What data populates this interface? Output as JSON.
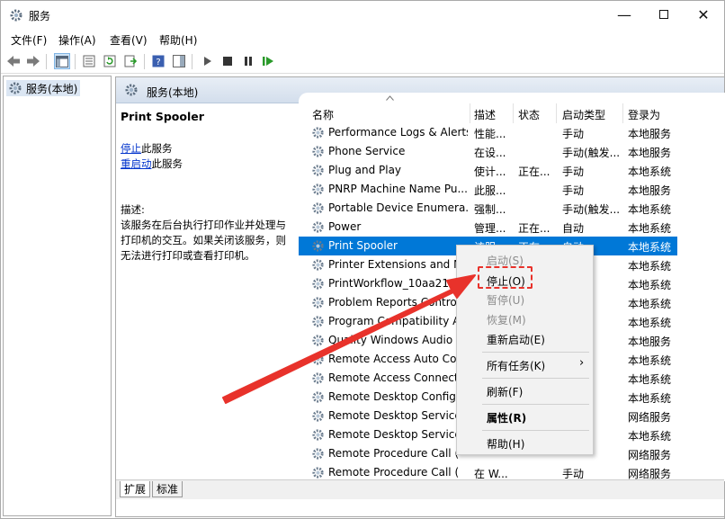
{
  "window": {
    "title": "服务"
  },
  "menu": [
    "文件(F)",
    "操作(A)",
    "查看(V)",
    "帮助(H)"
  ],
  "tree": {
    "root": "服务(本地)"
  },
  "main": {
    "header": "服务(本地)",
    "selected_name": "Print Spooler",
    "stop_link": "停止",
    "stop_suffix": "此服务",
    "restart_link": "重启动",
    "restart_suffix": "此服务",
    "desc_label": "描述:",
    "desc_text": "该服务在后台执行打印作业并处理与打印机的交互。如果关闭该服务，则无法进行打印或查看打印机。"
  },
  "columns": [
    "名称",
    "描述",
    "状态",
    "启动类型",
    "登录为"
  ],
  "rows": [
    [
      "Performance Logs & Alerts",
      "性能...",
      "",
      "手动",
      "本地服务"
    ],
    [
      "Phone Service",
      "在设...",
      "",
      "手动(触发...",
      "本地服务"
    ],
    [
      "Plug and Play",
      "使计...",
      "正在...",
      "手动",
      "本地系统"
    ],
    [
      "PNRP Machine Name Pu...",
      "此服...",
      "",
      "手动",
      "本地服务"
    ],
    [
      "Portable Device Enumera...",
      "强制...",
      "",
      "手动(触发...",
      "本地系统"
    ],
    [
      "Power",
      "管理...",
      "正在...",
      "自动",
      "本地系统"
    ],
    [
      "Print Spooler",
      "该服...",
      "正在...",
      "自动",
      "本地系统"
    ],
    [
      "Printer Extensions and N",
      "",
      "",
      "",
      "本地系统"
    ],
    [
      "PrintWorkflow_10aa21",
      "",
      "",
      "触发...",
      "本地系统"
    ],
    [
      "Problem Reports Contro",
      "",
      "",
      "",
      "本地系统"
    ],
    [
      "Program Compatibility A",
      "",
      "",
      "",
      "本地系统"
    ],
    [
      "Quality Windows Audio V",
      "",
      "",
      "",
      "本地服务"
    ],
    [
      "Remote Access Auto Cor",
      "",
      "",
      "",
      "本地系统"
    ],
    [
      "Remote Access Connecti",
      "",
      "",
      "",
      "本地系统"
    ],
    [
      "Remote Desktop Configu",
      "",
      "",
      "",
      "本地系统"
    ],
    [
      "Remote Desktop Service",
      "",
      "",
      "",
      "网络服务"
    ],
    [
      "Remote Desktop Service",
      "",
      "",
      "",
      "本地系统"
    ],
    [
      "Remote Procedure Call (",
      "",
      "",
      "",
      "网络服务"
    ],
    [
      "Remote Procedure Call (",
      "在 W...",
      "",
      "手动",
      "网络服务"
    ]
  ],
  "selected_row": 6,
  "context_menu": {
    "start": "启动(S)",
    "stop": "停止(O)",
    "pause": "暂停(U)",
    "resume": "恢复(M)",
    "restart": "重新启动(E)",
    "all_tasks": "所有任务(K)",
    "refresh": "刷新(F)",
    "properties": "属性(R)",
    "help": "帮助(H)"
  },
  "tabs": [
    "扩展",
    "标准"
  ],
  "colors": {
    "selection": "#0078d7",
    "highlight_box": "#e8322b",
    "arrow": "#e8322b",
    "link": "#0033cc"
  }
}
